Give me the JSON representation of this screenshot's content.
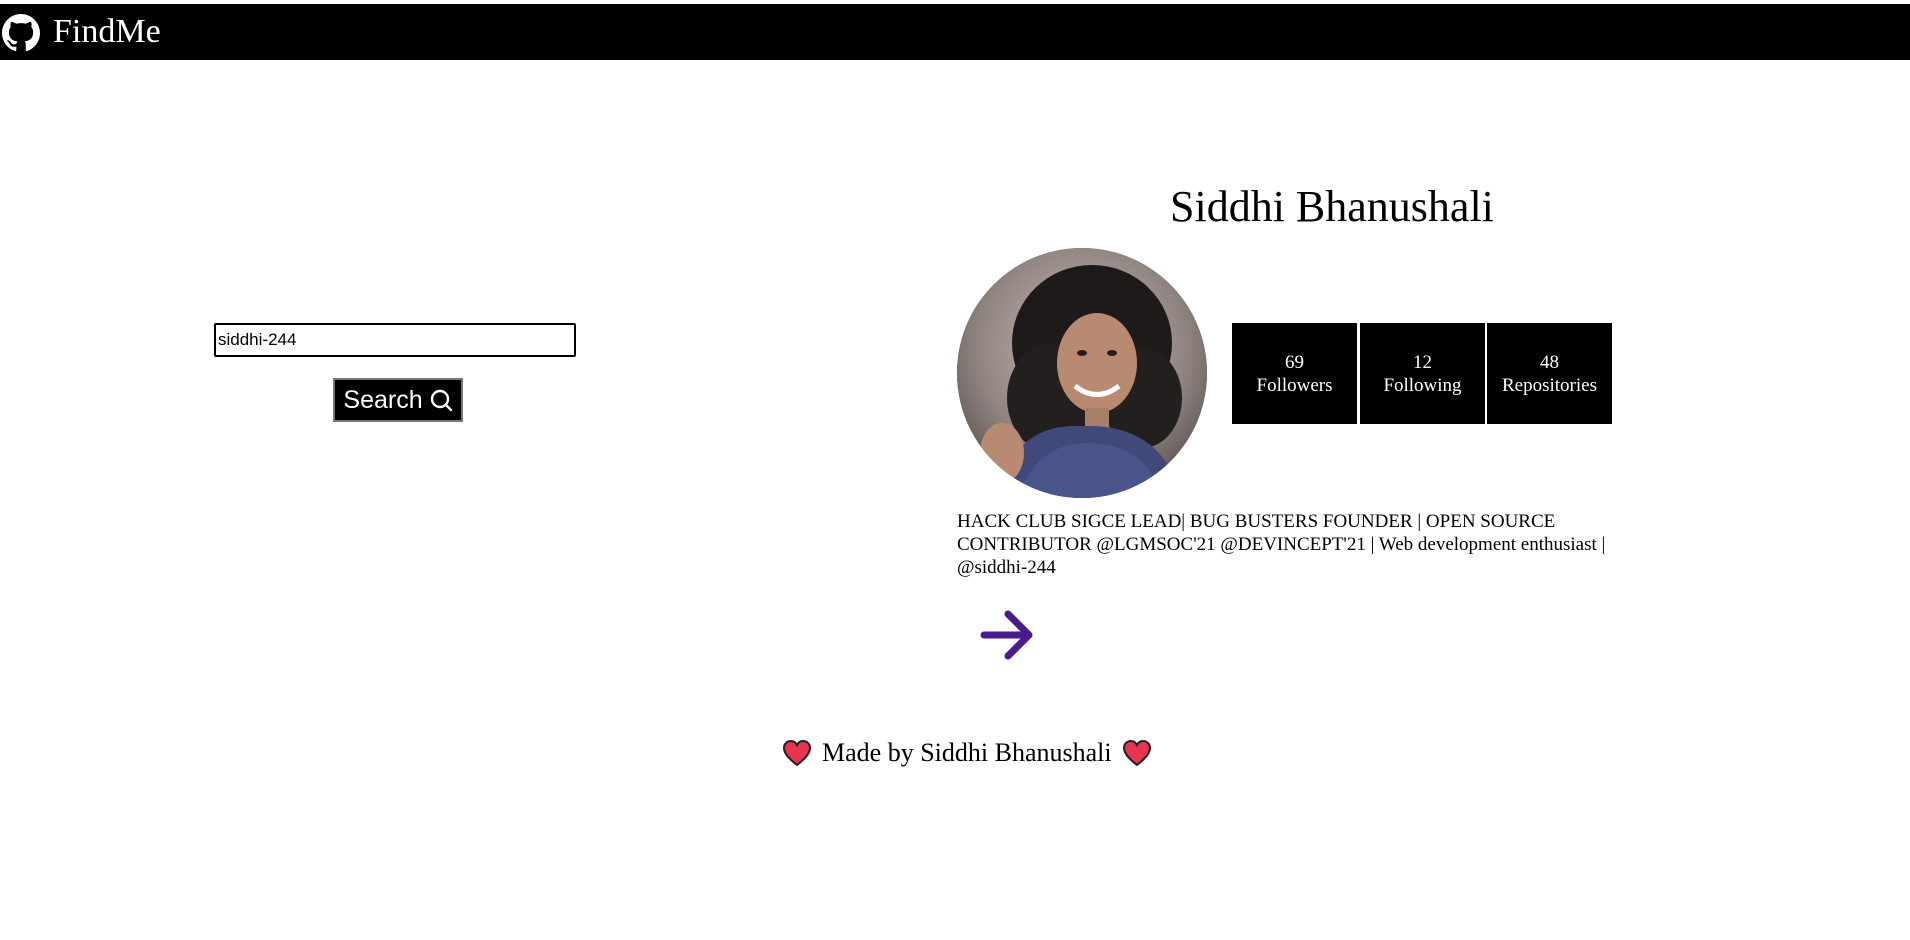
{
  "navbar": {
    "brand": "FindMe",
    "brand_icon": "github-icon"
  },
  "search": {
    "value": "siddhi-244",
    "button_label": "Search",
    "button_icon": "search-icon"
  },
  "profile": {
    "name": "Siddhi Bhanushali",
    "avatar": "profile-photo",
    "stats": [
      {
        "value": "69",
        "label": "Followers"
      },
      {
        "value": "12",
        "label": "Following"
      },
      {
        "value": "48",
        "label": "Repositories"
      }
    ],
    "bio": "HACK CLUB SIGCE LEAD| BUG BUSTERS FOUNDER | OPEN SOURCE CONTRIBUTOR @LGMSOC'21 @DEVINCEPT'21 | Web development enthusiast | @siddhi-244",
    "link_icon": "arrow-right-icon",
    "link_color": "#4b1a8c"
  },
  "footer": {
    "text": "Made by Siddhi Bhanushali",
    "heart_color": "#e8344e"
  }
}
